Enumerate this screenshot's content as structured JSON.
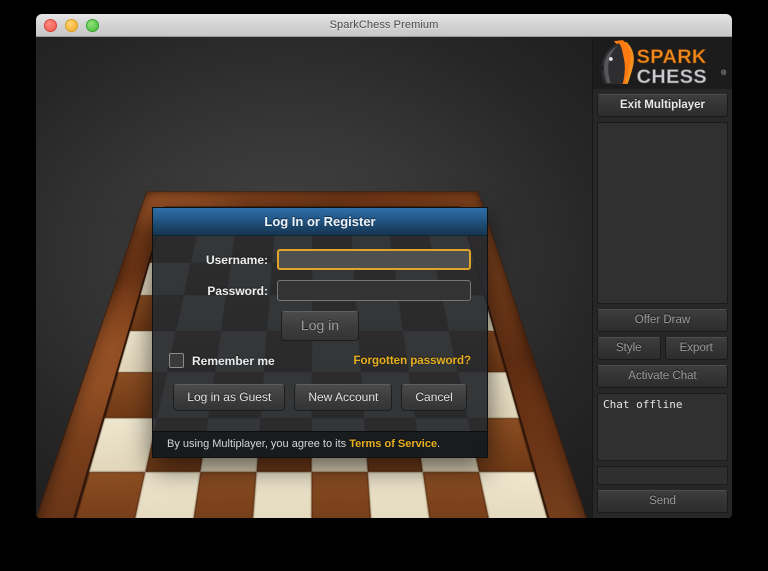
{
  "window": {
    "title": "SparkChess Premium",
    "traffic_lights": [
      "close",
      "minimize",
      "zoom"
    ]
  },
  "sidebar": {
    "logo": {
      "word_top": "SPARK",
      "word_bottom": "CHESS",
      "registered_mark": "®",
      "color_top": "#f08a1e",
      "color_bottom": "#c9cbce"
    },
    "exit_button": "Exit Multiplayer",
    "offer_draw_button": "Offer Draw",
    "style_button": "Style",
    "export_button": "Export",
    "activate_chat_button": "Activate Chat",
    "chat_log": "Chat offline",
    "chat_input_value": "",
    "chat_input_placeholder": "",
    "send_button": "Send"
  },
  "dialog": {
    "title": "Log In or Register",
    "username_label": "Username:",
    "username_value": "",
    "username_placeholder": "",
    "password_label": "Password:",
    "password_value": "",
    "password_placeholder": "",
    "login_button": "Log in",
    "remember_label": "Remember me",
    "remember_checked": false,
    "forgotten_link": "Forgotten password?",
    "guest_button": "Log in as Guest",
    "new_account_button": "New Account",
    "cancel_button": "Cancel",
    "footer_prefix": "By using Multiplayer, you agree to its ",
    "footer_link": "Terms of Service",
    "footer_suffix": ".",
    "accent_color": "#e8b01f",
    "header_color": "#245a8c"
  },
  "board": {
    "light_square_color": "#e7ddc1",
    "dark_square_color": "#7e4420",
    "frame_color": "#6d3516",
    "rows": 8,
    "cols": 8
  }
}
